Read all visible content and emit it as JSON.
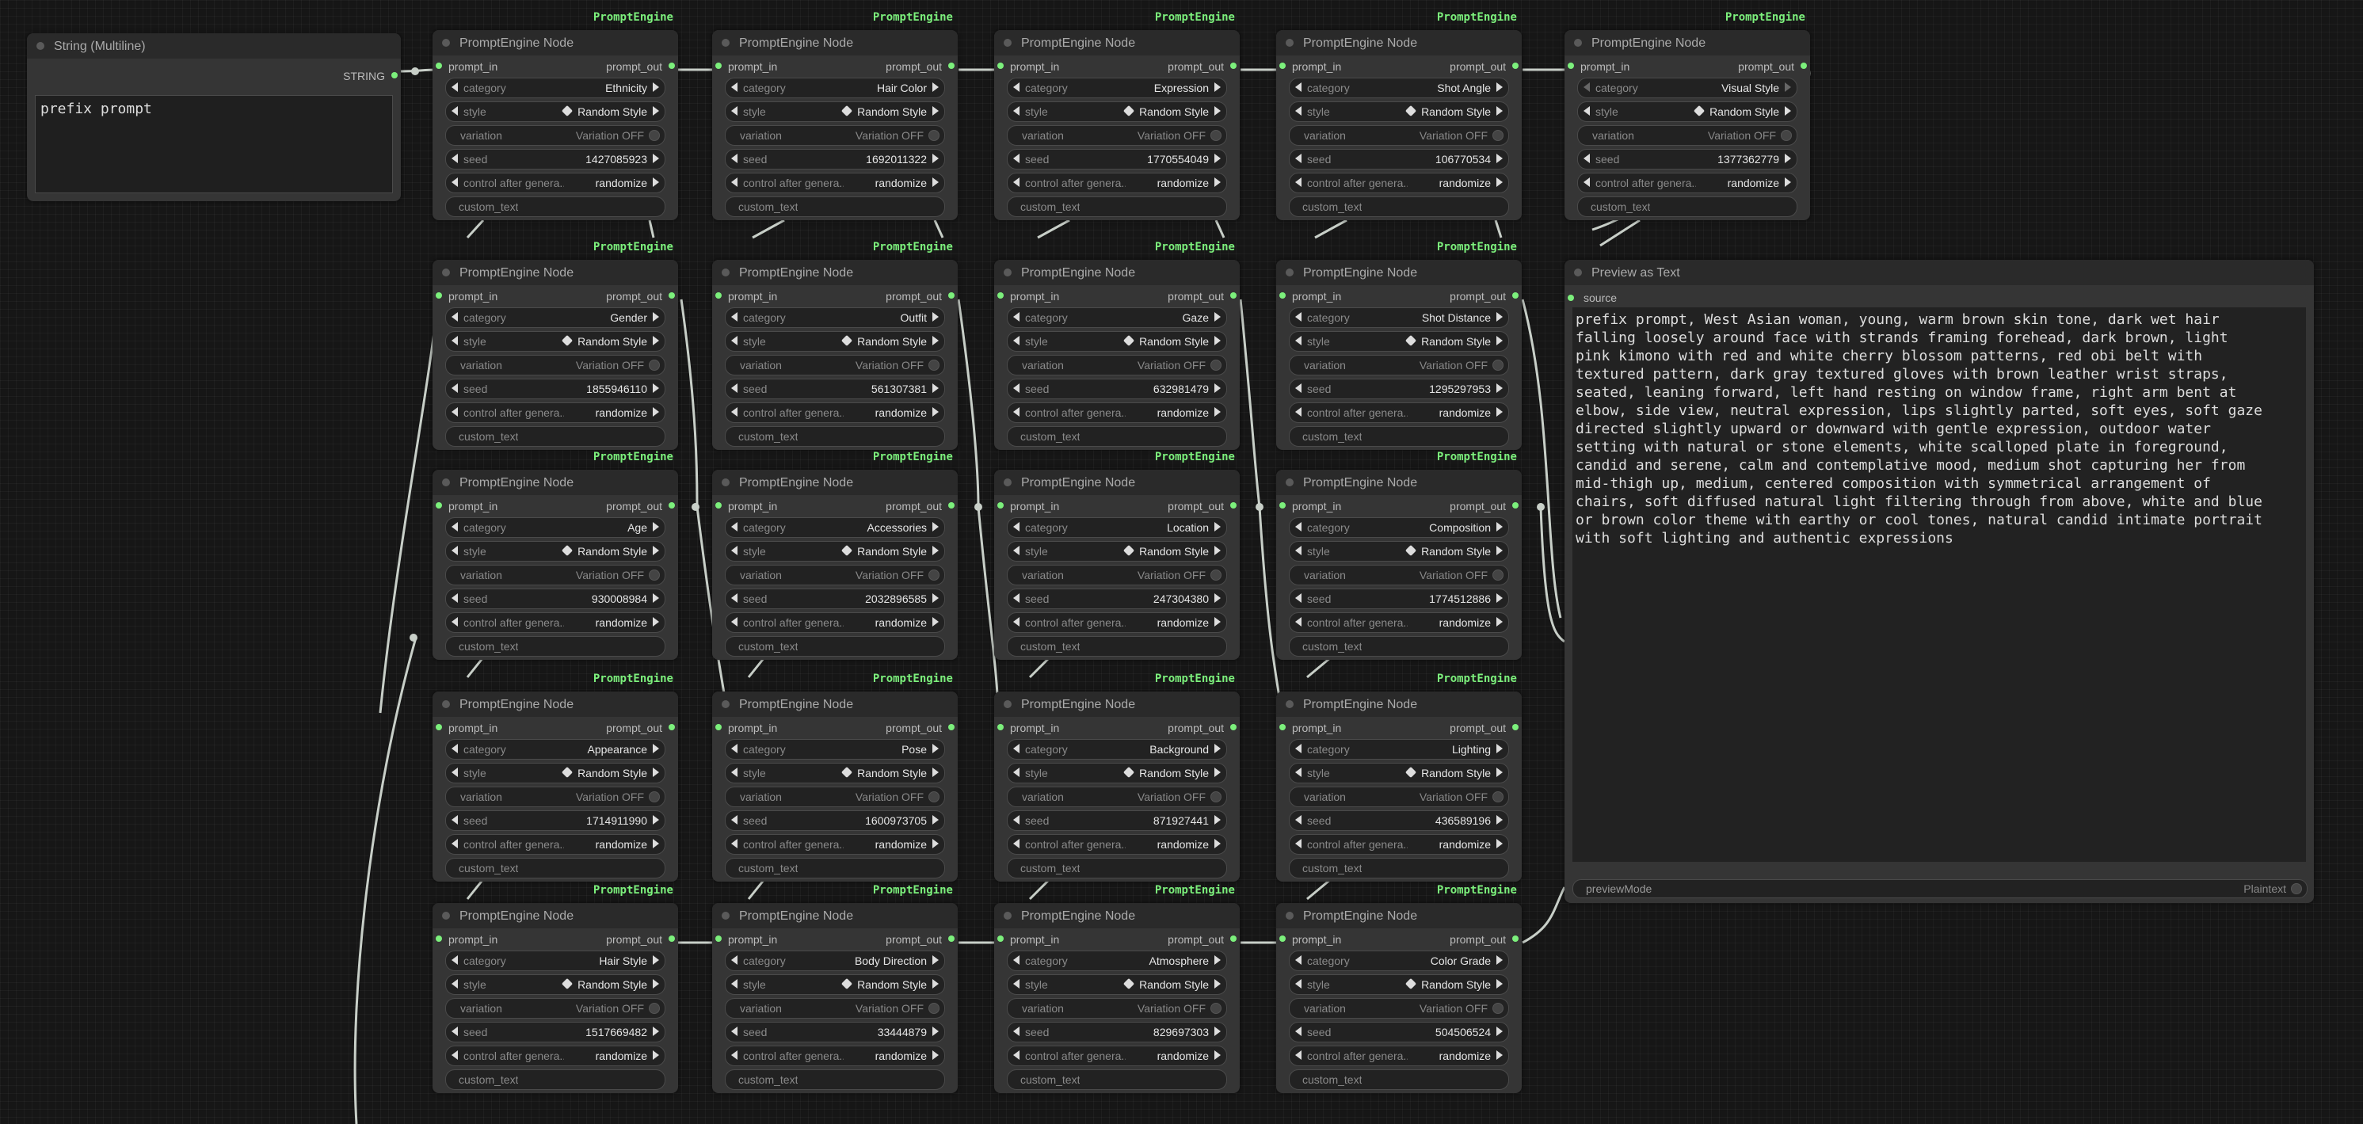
{
  "string_node": {
    "title": "String (Multiline)",
    "output": "STRING",
    "value": "prefix prompt"
  },
  "engine": {
    "title": "PromptEngine Node",
    "badge": "PromptEngine",
    "in": "prompt_in",
    "out": "prompt_out",
    "labels": {
      "category": "category",
      "style": "style",
      "variation": "variation",
      "seed": "seed",
      "control": "control after genera...",
      "custom": "custom_text"
    },
    "style_value": "Random Style",
    "variation_value": "Variation OFF",
    "control_value": "randomize"
  },
  "nodes": [
    {
      "category": "Ethnicity",
      "seed": "1427085923"
    },
    {
      "category": "Hair Color",
      "seed": "1692011322"
    },
    {
      "category": "Expression",
      "seed": "1770554049"
    },
    {
      "category": "Shot Angle",
      "seed": "106770534"
    },
    {
      "category": "Visual Style",
      "seed": "1377362779"
    },
    {
      "category": "Gender",
      "seed": "1855946110"
    },
    {
      "category": "Outfit",
      "seed": "561307381"
    },
    {
      "category": "Gaze",
      "seed": "632981479"
    },
    {
      "category": "Shot Distance",
      "seed": "1295297953"
    },
    {
      "category": "Age",
      "seed": "930008984"
    },
    {
      "category": "Accessories",
      "seed": "2032896585"
    },
    {
      "category": "Location",
      "seed": "247304380"
    },
    {
      "category": "Composition",
      "seed": "1774512886"
    },
    {
      "category": "Appearance",
      "seed": "1714911990"
    },
    {
      "category": "Pose",
      "seed": "1600973705"
    },
    {
      "category": "Background",
      "seed": "871927441"
    },
    {
      "category": "Lighting",
      "seed": "436589196"
    },
    {
      "category": "Hair Style",
      "seed": "1517669482"
    },
    {
      "category": "Body Direction",
      "seed": "33444879"
    },
    {
      "category": "Atmosphere",
      "seed": "829697303"
    },
    {
      "category": "Color Grade",
      "seed": "504506524"
    }
  ],
  "preview": {
    "title": "Preview as Text",
    "source": "source",
    "text": "prefix prompt, West Asian woman, young, warm brown skin tone, dark wet hair\nfalling loosely around face with strands framing forehead, dark brown, light\npink kimono with red and white cherry blossom patterns, red obi belt with\ntextured pattern, dark gray textured gloves with brown leather wrist straps,\nseated, leaning forward, left hand resting on window frame, right arm bent at\nelbow, side view, neutral expression, lips slightly parted, soft eyes, soft gaze\ndirected slightly upward or downward with gentle expression, outdoor water\nsetting with natural or stone elements, white scalloped plate in foreground,\ncandid and serene, calm and contemplative mood, medium shot capturing her from\nmid-thigh up, medium, centered composition with symmetrical arrangement of\nchairs, soft diffused natural light filtering through from above, white and blue\nor brown color theme with earthy or cool tones, natural candid intimate portrait\nwith soft lighting and authentic expressions",
    "mode_label": "previewMode",
    "mode_value": "Plaintext"
  }
}
